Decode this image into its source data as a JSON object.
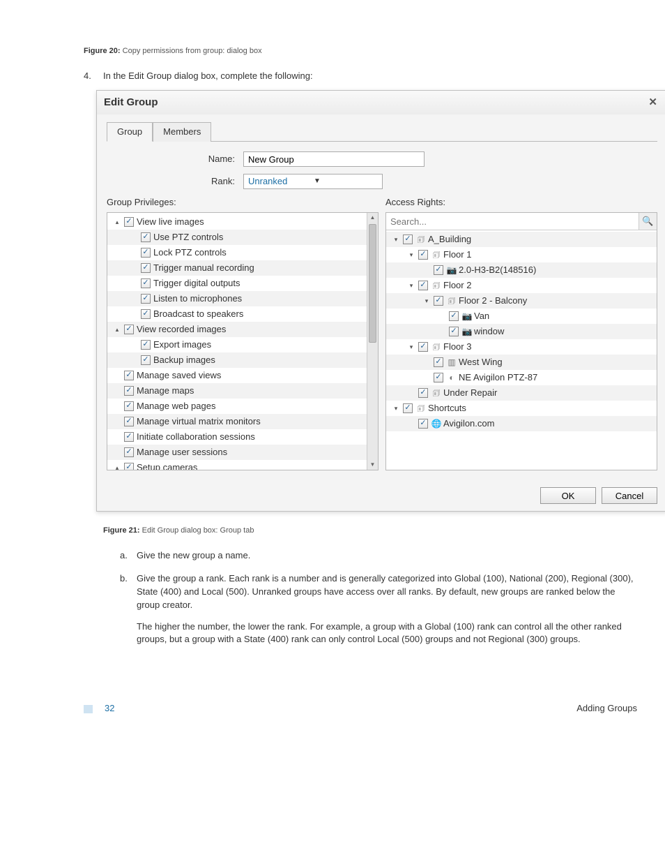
{
  "figure20": {
    "label": "Figure 20:",
    "text": "Copy permissions from group: dialog box"
  },
  "step4": {
    "num": "4",
    "text": "In the Edit Group dialog box, complete the following:"
  },
  "dialog": {
    "title": "Edit Group",
    "tabs": {
      "group": "Group",
      "members": "Members"
    },
    "name_label": "Name:",
    "name_value": "New Group",
    "rank_label": "Rank:",
    "rank_value": "Unranked",
    "privileges_label": "Group Privileges:",
    "rights_label": "Access Rights:",
    "search_placeholder": "Search...",
    "ok": "OK",
    "cancel": "Cancel",
    "privileges": [
      {
        "depth": 0,
        "disclose": "▴",
        "label": "View live images"
      },
      {
        "depth": 1,
        "label": "Use PTZ controls"
      },
      {
        "depth": 1,
        "label": "Lock PTZ controls"
      },
      {
        "depth": 1,
        "label": "Trigger manual recording"
      },
      {
        "depth": 1,
        "label": "Trigger digital outputs"
      },
      {
        "depth": 1,
        "label": "Listen to microphones"
      },
      {
        "depth": 1,
        "label": "Broadcast to speakers"
      },
      {
        "depth": 0,
        "disclose": "▴",
        "label": "View recorded images"
      },
      {
        "depth": 1,
        "label": "Export images"
      },
      {
        "depth": 1,
        "label": "Backup images"
      },
      {
        "depth": 0,
        "label": "Manage saved views"
      },
      {
        "depth": 0,
        "label": "Manage maps"
      },
      {
        "depth": 0,
        "label": "Manage web pages"
      },
      {
        "depth": 0,
        "label": "Manage virtual matrix monitors"
      },
      {
        "depth": 0,
        "label": "Initiate collaboration sessions"
      },
      {
        "depth": 0,
        "label": "Manage user sessions"
      },
      {
        "depth": 0,
        "disclose": "▴",
        "label": "Setup cameras"
      }
    ],
    "rights": [
      {
        "depth": 0,
        "disclose": "▾",
        "icon": "site",
        "label": "A_Building"
      },
      {
        "depth": 1,
        "disclose": "▾",
        "icon": "site",
        "label": "Floor 1"
      },
      {
        "depth": 2,
        "icon": "cam",
        "label": "2.0-H3-B2(148516)"
      },
      {
        "depth": 1,
        "disclose": "▾",
        "icon": "site",
        "label": "Floor 2"
      },
      {
        "depth": 2,
        "disclose": "▾",
        "icon": "site",
        "label": "Floor 2 - Balcony"
      },
      {
        "depth": 3,
        "icon": "cam",
        "label": "Van"
      },
      {
        "depth": 3,
        "icon": "cam",
        "label": "window"
      },
      {
        "depth": 1,
        "disclose": "▾",
        "icon": "site",
        "label": "Floor 3"
      },
      {
        "depth": 2,
        "icon": "enc",
        "label": "West Wing"
      },
      {
        "depth": 2,
        "icon": "dome",
        "label": "NE Avigilon PTZ-87"
      },
      {
        "depth": 1,
        "icon": "site",
        "label": "Under Repair"
      },
      {
        "depth": 0,
        "disclose": "▾",
        "icon": "site",
        "label": "Shortcuts"
      },
      {
        "depth": 1,
        "icon": "web",
        "label": "Avigilon.com"
      }
    ]
  },
  "figure21": {
    "label": "Figure 21:",
    "text": "Edit Group dialog box: Group tab"
  },
  "steps_alpha": {
    "a": {
      "lt": "a",
      "text": "Give the new group a name."
    },
    "b": {
      "lt": "b",
      "text": "Give the group a rank. Each rank is a number and is generally categorized into Global (100), National (200), Regional (300), State (400) and Local (500). Unranked groups have access over all ranks. By default, new groups are ranked below the group creator."
    },
    "b2": "The higher the number, the lower the rank. For example, a group with a Global (100) rank can control all the other ranked groups, but a group with a State (400) rank can only control Local (500) groups and not Regional (300) groups."
  },
  "footer": {
    "page": "32",
    "section": "Adding Groups"
  }
}
